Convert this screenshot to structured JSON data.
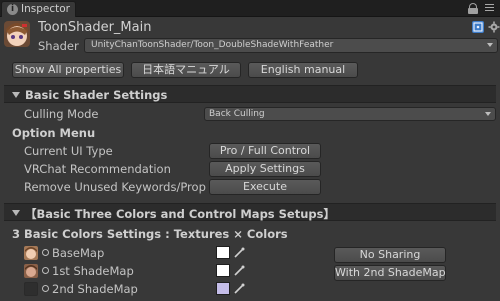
{
  "tab": {
    "label": "Inspector"
  },
  "header": {
    "title": "ToonShader_Main",
    "shader_label": "Shader",
    "shader_value": "UnityChanToonShader/Toon_DoubleShadeWithFeather"
  },
  "toolbar": {
    "show_all": "Show All properties",
    "japanese_manual": "日本語マニュアル",
    "english_manual": "English manual"
  },
  "basic_settings": {
    "title": "Basic Shader Settings",
    "culling_label": "Culling Mode",
    "culling_value": "Back Culling"
  },
  "option_menu": {
    "title": "Option Menu",
    "rows": [
      {
        "label": "Current UI Type",
        "button": "Pro / Full Control"
      },
      {
        "label": "VRChat Recommendation",
        "button": "Apply Settings"
      },
      {
        "label": "Remove Unused Keywords/Properti",
        "button": "Execute"
      }
    ]
  },
  "three_colors": {
    "title": "【Basic Three Colors and Control Maps Setups】",
    "subtitle": "3 Basic Colors Settings : Textures × Colors",
    "rows": [
      {
        "label": "BaseMap",
        "button": "No Sharing",
        "swatch": "#ffffff"
      },
      {
        "label": "1st ShadeMap",
        "button": "With 2nd ShadeMap",
        "swatch": "#ffffff"
      },
      {
        "label": "2nd ShadeMap",
        "button": "",
        "swatch": "#c4bde8"
      }
    ]
  },
  "colors": {
    "background": "#383838",
    "section": "#2c2c2c",
    "tabbar": "#1f1f1f",
    "help_icon": "#3d7cc9"
  },
  "icons": [
    "info-icon",
    "lock-icon",
    "menu-icon",
    "help-icon",
    "settings-icon",
    "foldout-icon",
    "texture-picker-icon",
    "eyedropper-icon"
  ]
}
